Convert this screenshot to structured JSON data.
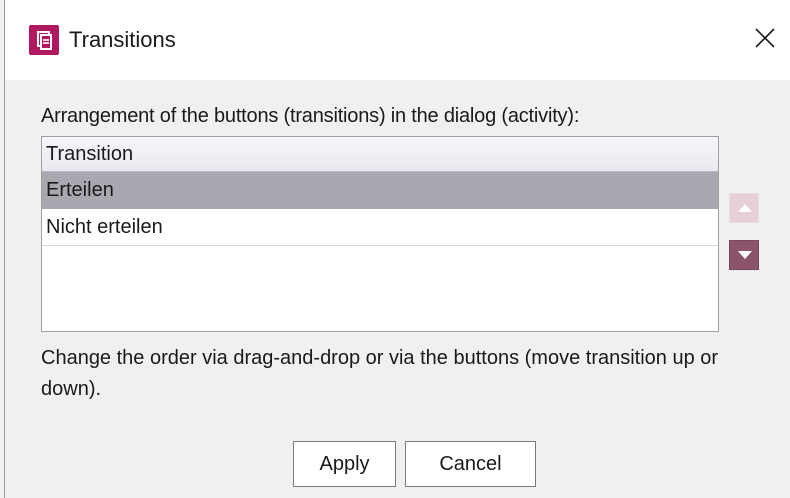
{
  "window": {
    "title": "Transitions",
    "icon": "document-icon",
    "accent_color": "#b0195f"
  },
  "instruction": "Arrangement of the buttons (transitions) in the dialog (activity):",
  "list": {
    "column_header": "Transition",
    "items": [
      {
        "label": "Erteilen",
        "selected": true
      },
      {
        "label": "Nicht erteilen",
        "selected": false
      }
    ]
  },
  "reorder": {
    "up_icon": "triangle-up-icon",
    "down_icon": "triangle-down-icon"
  },
  "help_text": "Change the order via drag-and-drop or via the buttons (move transition up or down).",
  "buttons": {
    "apply": "Apply",
    "cancel": "Cancel"
  }
}
